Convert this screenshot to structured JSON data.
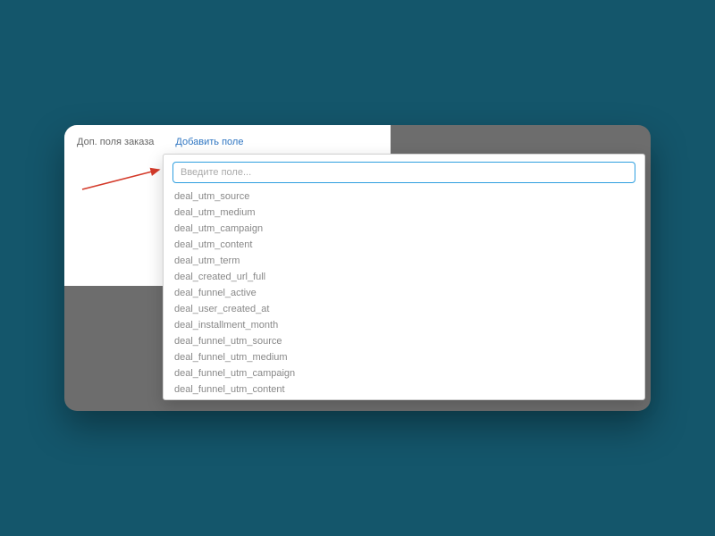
{
  "header": {
    "label": "Доп. поля заказа",
    "add_link": "Добавить поле"
  },
  "search": {
    "placeholder": "Введите поле..."
  },
  "options": [
    "deal_utm_source",
    "deal_utm_medium",
    "deal_utm_campaign",
    "deal_utm_content",
    "deal_utm_term",
    "deal_created_url_full",
    "deal_funnel_active",
    "deal_user_created_at",
    "deal_installment_month",
    "deal_funnel_utm_source",
    "deal_funnel_utm_medium",
    "deal_funnel_utm_campaign",
    "deal_funnel_utm_content"
  ],
  "colors": {
    "accent": "#2f76c2",
    "input_border": "#2f9fe0",
    "bg": "#14566b",
    "card_bg": "#6d6d6d"
  }
}
